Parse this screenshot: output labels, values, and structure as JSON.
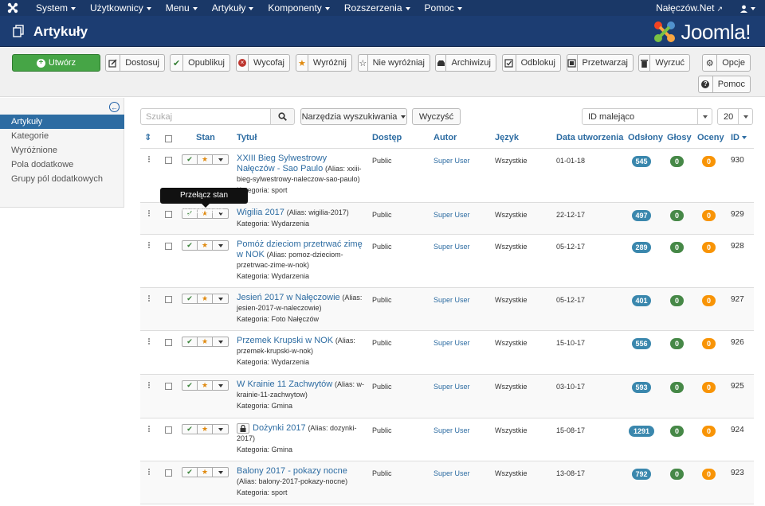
{
  "topnav": {
    "menu": [
      "System",
      "Użytkownicy",
      "Menu",
      "Artykuły",
      "Komponenty",
      "Rozszerzenia",
      "Pomoc"
    ],
    "site_link": "Nałęczów.Net"
  },
  "header": {
    "title": "Artykuły",
    "brand": "Joomla!"
  },
  "toolbar": {
    "create": "Utwórz",
    "edit": "Dostosuj",
    "publish": "Opublikuj",
    "unpublish": "Wycofaj",
    "feature": "Wyróżnij",
    "unfeature": "Nie wyróżniaj",
    "archive": "Archiwizuj",
    "checkin": "Odblokuj",
    "batch": "Przetwarzaj",
    "trash": "Wyrzuć",
    "options": "Opcje",
    "help": "Pomoc"
  },
  "sidebar": {
    "items": [
      "Artykuły",
      "Kategorie",
      "Wyróżnione",
      "Pola dodatkowe",
      "Grupy pól dodatkowych"
    ]
  },
  "filters": {
    "search_placeholder": "Szukaj",
    "search_tools": "Narzędzia wyszukiwania",
    "clear": "Wyczyść",
    "ordering": "ID malejąco",
    "limit": "20"
  },
  "table": {
    "columns": {
      "status": "Stan",
      "title": "Tytuł",
      "access": "Dostęp",
      "author": "Autor",
      "language": "Język",
      "created": "Data utworzenia",
      "hits": "Odsłony",
      "votes": "Głosy",
      "ratings": "Oceny",
      "id": "ID"
    },
    "rows": [
      {
        "title": "XXIII Bieg Sylwestrowy Nałęczów - Sao Paulo",
        "alias": "(Alias: xxiii-bieg-sylwestrowy-naleczow-sao-paulo)",
        "category": "Kategoria: sport",
        "access": "Public",
        "author": "Super User",
        "language": "Wszystkie",
        "date": "01-01-18",
        "hits": "545",
        "votes": "0",
        "ratings": "0",
        "id": "930",
        "locked": false
      },
      {
        "title": "Wigilia 2017",
        "alias": "(Alias: wigilia-2017)",
        "category": "Kategoria: Wydarzenia",
        "access": "Public",
        "author": "Super User",
        "language": "Wszystkie",
        "date": "22-12-17",
        "hits": "497",
        "votes": "0",
        "ratings": "0",
        "id": "929",
        "locked": false
      },
      {
        "title": "Pomóż dzieciom przetrwać zimę w NOK",
        "alias": "(Alias: pomoz-dzieciom-przetrwac-zime-w-nok)",
        "category": "Kategoria: Wydarzenia",
        "access": "Public",
        "author": "Super User",
        "language": "Wszystkie",
        "date": "05-12-17",
        "hits": "289",
        "votes": "0",
        "ratings": "0",
        "id": "928",
        "locked": false
      },
      {
        "title": "Jesień 2017 w Nałęczowie",
        "alias": "(Alias: jesien-2017-w-naleczowie)",
        "category": "Kategoria: Foto Nałęczów",
        "access": "Public",
        "author": "Super User",
        "language": "Wszystkie",
        "date": "05-12-17",
        "hits": "401",
        "votes": "0",
        "ratings": "0",
        "id": "927",
        "locked": false
      },
      {
        "title": "Przemek Krupski w NOK",
        "alias": "(Alias: przemek-krupski-w-nok)",
        "category": "Kategoria: Wydarzenia",
        "access": "Public",
        "author": "Super User",
        "language": "Wszystkie",
        "date": "15-10-17",
        "hits": "556",
        "votes": "0",
        "ratings": "0",
        "id": "926",
        "locked": false
      },
      {
        "title": "W Krainie 11 Zachwytów",
        "alias": "(Alias: w-krainie-11-zachwytow)",
        "category": "Kategoria: Gmina",
        "access": "Public",
        "author": "Super User",
        "language": "Wszystkie",
        "date": "03-10-17",
        "hits": "593",
        "votes": "0",
        "ratings": "0",
        "id": "925",
        "locked": false
      },
      {
        "title": "Dożynki 2017",
        "alias": "(Alias: dozynki-2017)",
        "category": "Kategoria: Gmina",
        "access": "Public",
        "author": "Super User",
        "language": "Wszystkie",
        "date": "15-08-17",
        "hits": "1291",
        "votes": "0",
        "ratings": "0",
        "id": "924",
        "locked": true
      },
      {
        "title": "Balony 2017 - pokazy nocne",
        "alias": "(Alias: balony-2017-pokazy-nocne)",
        "category": "Kategoria: sport",
        "access": "Public",
        "author": "Super User",
        "language": "Wszystkie",
        "date": "13-08-17",
        "hits": "792",
        "votes": "0",
        "ratings": "0",
        "id": "923",
        "locked": false
      }
    ]
  },
  "tooltip": "Przełącz stan wyróżnienia."
}
